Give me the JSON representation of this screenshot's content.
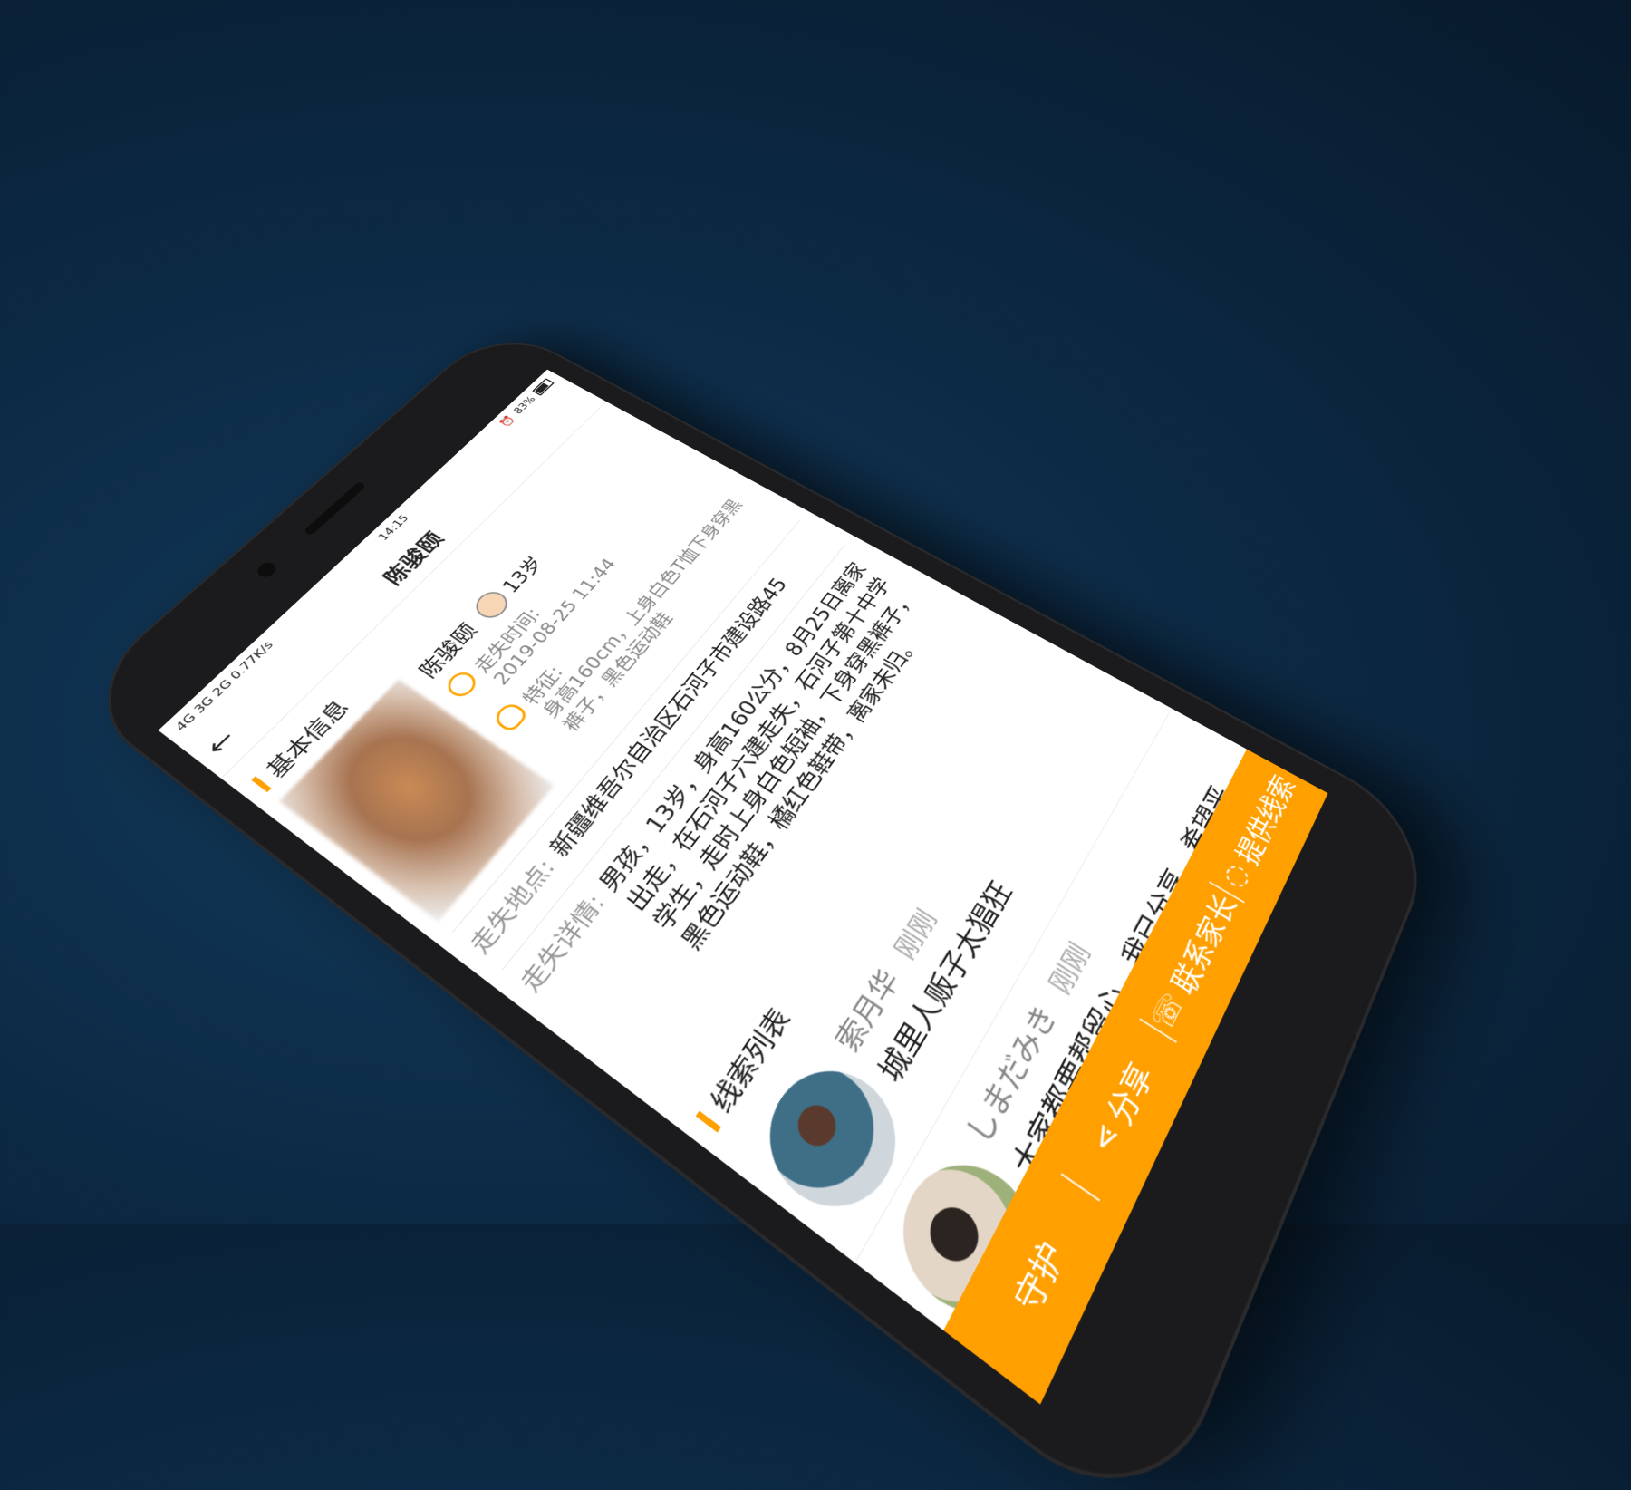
{
  "status_bar": {
    "network": "4G 3G 2G",
    "speed": "0.77K/s",
    "time": "14:15",
    "battery": "83%"
  },
  "nav": {
    "back_icon": "arrow-left-icon",
    "title": "陈骏颐"
  },
  "basic_info": {
    "section_title": "基本信息",
    "name": "陈骏颐",
    "age": "13岁",
    "lost_time_label": "走失时间:",
    "lost_time_value": "2019-08-25 11:44",
    "features_label": "特征:",
    "features_value": "身高160cm，上身白色T恤下身穿黑裤子，黑色运动鞋"
  },
  "details": {
    "location_label": "走失地点:",
    "location_value": "新疆维吾尔自治区石河子市建设路45",
    "detail_label": "走失详情:",
    "detail_value": "男孩，13岁，身高160公分，8月25日离家出走，在石河子六建走失，石河子第十中学学生，走时上身白色短袖，下身穿黑裤子，黑色运动鞋，橘红色鞋带，离家未归。"
  },
  "clues": {
    "section_title": "线索列表",
    "items": [
      {
        "name": "索月华",
        "time": "刚刚",
        "text": "城里人贩子太猖狂"
      },
      {
        "name": "しまだみき",
        "time": "刚刚",
        "text": "大家都要帮留心，我已分享，希望平安！"
      }
    ]
  },
  "bottom_bar": {
    "guard": "守护",
    "share": "分享",
    "contact": "联系家长",
    "provide": "提供线索"
  },
  "colors": {
    "accent": "#ff9f00",
    "background": "#0c2a45"
  }
}
